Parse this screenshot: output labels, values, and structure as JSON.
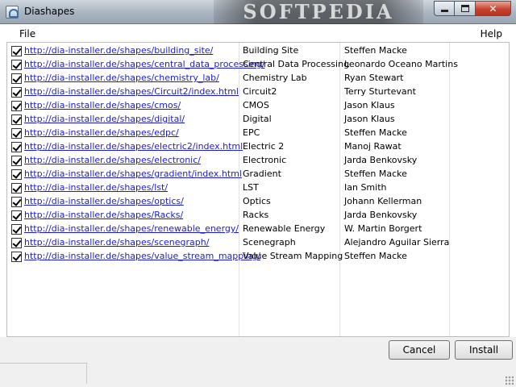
{
  "window": {
    "title": "Diashapes",
    "watermark": "SOFTPEDIA",
    "icon": "app-icon",
    "controls": {
      "minimize_icon": "minimize-icon",
      "maximize_icon": "maximize-icon",
      "close_glyph": "✕"
    }
  },
  "menu": {
    "file": "File",
    "help": "Help"
  },
  "shapes": [
    {
      "checked": true,
      "url": "http://dia-installer.de/shapes/building_site/",
      "name": "Building Site",
      "author": "Steffen Macke"
    },
    {
      "checked": true,
      "url": "http://dia-installer.de/shapes/central_data_processing/",
      "name": "Central Data Processing",
      "author": "Leonardo Oceano Martins"
    },
    {
      "checked": true,
      "url": "http://dia-installer.de/shapes/chemistry_lab/",
      "name": "Chemistry Lab",
      "author": "Ryan Stewart"
    },
    {
      "checked": true,
      "url": "http://dia-installer.de/shapes/Circuit2/index.html",
      "name": "Circuit2",
      "author": "Terry Sturtevant"
    },
    {
      "checked": true,
      "url": "http://dia-installer.de/shapes/cmos/",
      "name": "CMOS",
      "author": "Jason Klaus"
    },
    {
      "checked": true,
      "url": "http://dia-installer.de/shapes/digital/",
      "name": "Digital",
      "author": "Jason Klaus"
    },
    {
      "checked": true,
      "url": "http://dia-installer.de/shapes/edpc/",
      "name": "EPC",
      "author": "Steffen Macke"
    },
    {
      "checked": true,
      "url": "http://dia-installer.de/shapes/electric2/index.html",
      "name": "Electric 2",
      "author": "Manoj Rawat"
    },
    {
      "checked": true,
      "url": "http://dia-installer.de/shapes/electronic/",
      "name": "Electronic",
      "author": "Jarda Benkovsky"
    },
    {
      "checked": true,
      "url": "http://dia-installer.de/shapes/gradient/index.html",
      "name": "Gradient",
      "author": "Steffen Macke"
    },
    {
      "checked": true,
      "url": "http://dia-installer.de/shapes/lst/",
      "name": "LST",
      "author": "Ian Smith"
    },
    {
      "checked": true,
      "url": "http://dia-installer.de/shapes/optics/",
      "name": "Optics",
      "author": "Johann Kellerman"
    },
    {
      "checked": true,
      "url": "http://dia-installer.de/shapes/Racks/",
      "name": "Racks",
      "author": "Jarda Benkovsky"
    },
    {
      "checked": true,
      "url": "http://dia-installer.de/shapes/renewable_energy/",
      "name": "Renewable Energy",
      "author": "W. Martin Borgert"
    },
    {
      "checked": true,
      "url": "http://dia-installer.de/shapes/scenegraph/",
      "name": "Scenegraph",
      "author": "Alejandro Aguilar Sierra"
    },
    {
      "checked": true,
      "url": "http://dia-installer.de/shapes/value_stream_mapping/",
      "name": "Value Stream Mapping",
      "author": "Steffen Macke"
    }
  ],
  "buttons": {
    "cancel": "Cancel",
    "install": "Install"
  },
  "colors": {
    "link": "#1c1ccf",
    "close_button": "#c7432d"
  }
}
